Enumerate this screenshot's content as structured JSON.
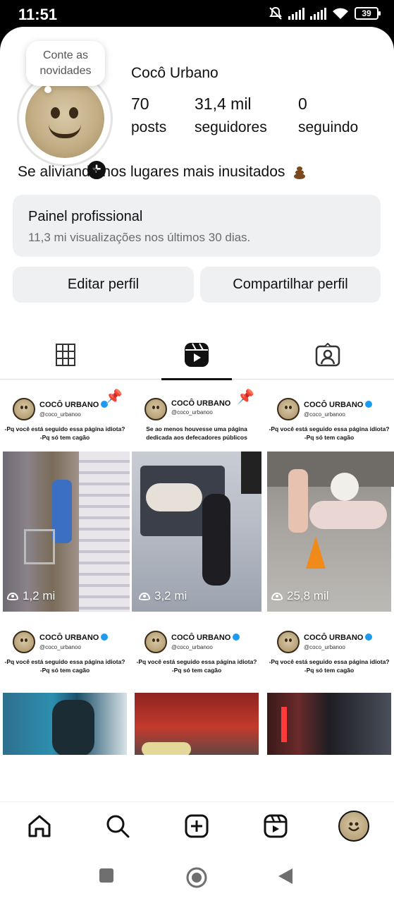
{
  "status": {
    "time": "11:51",
    "battery": "39"
  },
  "profile": {
    "note": "Conte as novidades",
    "name": "Cocô Urbano",
    "stats": [
      {
        "value": "70",
        "label": "posts"
      },
      {
        "value": "31,4 mil",
        "label": "seguidores"
      },
      {
        "value": "0",
        "label": "seguindo"
      }
    ],
    "bio": "Se aliviando nos lugares mais inusitados"
  },
  "panel": {
    "title": "Painel profissional",
    "subtitle": "11,3 mi visualizações nos últimos 30 dias."
  },
  "buttons": {
    "edit": "Editar perfil",
    "share": "Compartilhar perfil"
  },
  "tabs": [
    "grid-icon",
    "reels-icon",
    "tagged-icon"
  ],
  "posts": [
    {
      "brand": "COCÔ URBANO",
      "handle": "@coco_urbanoo",
      "caption": "-Pq você está seguido essa página idiota? -Pq só tem cagão",
      "views": "1,2 mi",
      "pinned": true
    },
    {
      "brand": "COCÔ URBANO",
      "handle": "@coco_urbanoo",
      "caption": "Se ao menos houvesse uma página dedicada aos defecadores públicos",
      "views": "3,2 mi",
      "pinned": true
    },
    {
      "brand": "COCÔ URBANO",
      "handle": "@coco_urbanoo",
      "caption": "-Pq você está seguido essa página idiota? -Pq só tem cagão",
      "views": "25,8 mil",
      "pinned": false
    },
    {
      "brand": "COCÔ URBANO",
      "handle": "@coco_urbanoo",
      "caption": "-Pq você está seguido essa página idiota? -Pq só tem cagão",
      "views": "",
      "pinned": false
    },
    {
      "brand": "COCÔ URBANO",
      "handle": "@coco_urbanoo",
      "caption": "-Pq você está seguido essa página idiota? -Pq só tem cagão",
      "views": "",
      "pinned": false
    },
    {
      "brand": "COCÔ URBANO",
      "handle": "@coco_urbanoo",
      "caption": "-Pq você está seguido essa página idiota? -Pq só tem cagão",
      "views": "",
      "pinned": false
    }
  ],
  "bottom_nav": [
    "home-icon",
    "search-icon",
    "create-icon",
    "reels-icon",
    "profile-avatar"
  ],
  "colors": {
    "accent": "#111111",
    "panel_bg": "#eff0f2",
    "verified": "#1d9bf0"
  }
}
